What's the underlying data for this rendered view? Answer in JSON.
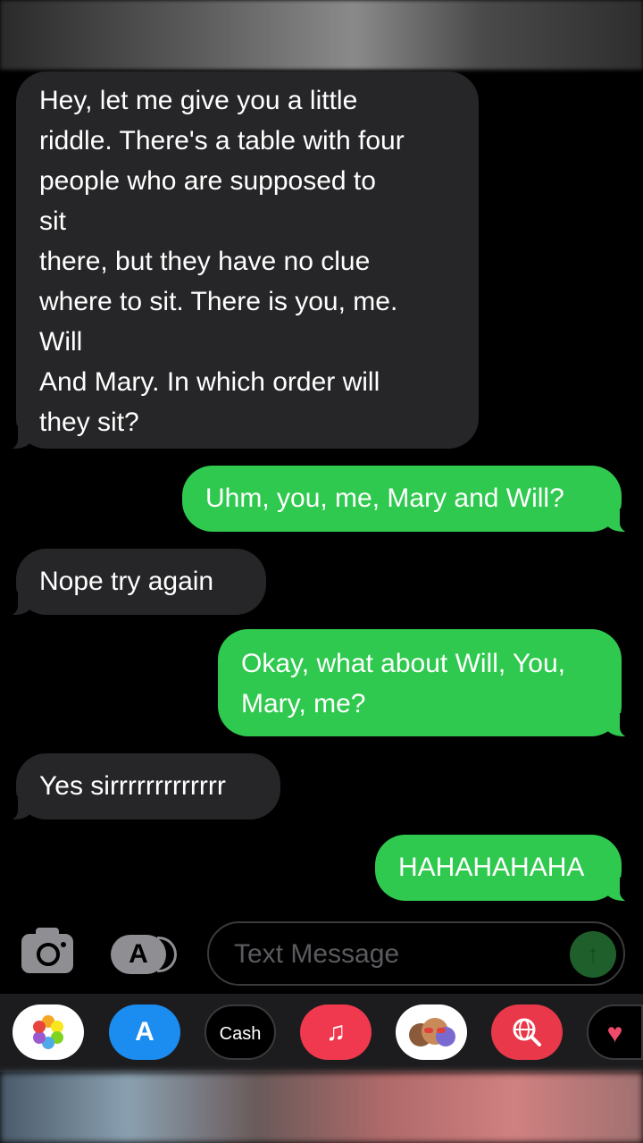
{
  "conversation": {
    "messages": [
      {
        "direction": "incoming",
        "text": "Hey, let me give you a little\nriddle. There's a table with four\npeople who are supposed to\nsit\nthere, but they have no clue\nwhere to sit. There is you, me.\nWill\nAnd Mary. In which order will\nthey sit?"
      },
      {
        "direction": "outgoing",
        "text": "Uhm, you, me, Mary and Will?"
      },
      {
        "direction": "incoming",
        "text": "Nope try again"
      },
      {
        "direction": "outgoing",
        "text": "Okay, what about Will, You,\nMary, me?"
      },
      {
        "direction": "incoming",
        "text": "Yes sirrrrrrrrrrrrr"
      },
      {
        "direction": "outgoing",
        "text": "HAHAHAHAHA"
      }
    ]
  },
  "compose": {
    "placeholder": "Text Message",
    "camera_icon": "camera-icon",
    "apps_icon": "app-store-icon",
    "send_icon": "arrow-up-icon"
  },
  "app_tray": {
    "items": [
      {
        "name": "photos-icon"
      },
      {
        "name": "app-store-icon"
      },
      {
        "name": "apple-cash-icon",
        "label": "Cash"
      },
      {
        "name": "music-icon",
        "glyph": "♫"
      },
      {
        "name": "memoji-icon"
      },
      {
        "name": "search-images-icon"
      },
      {
        "name": "heart-icon",
        "glyph": "♥"
      }
    ]
  },
  "colors": {
    "incoming_bubble": "#262628",
    "outgoing_bubble": "#30c94f",
    "background": "#000000"
  }
}
